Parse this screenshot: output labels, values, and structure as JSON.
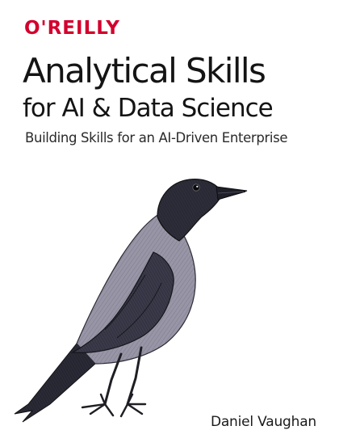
{
  "publisher": {
    "name": "O'REILLY",
    "color": "#d3002d"
  },
  "book": {
    "title_line1": "Analytical Skills",
    "title_line2": "for AI & Data Science",
    "subtitle": "Building Skills for an AI-Driven Enterprise",
    "author": "Daniel Vaughan"
  },
  "illustration": {
    "subject": "crow",
    "colors": {
      "head": "#2b2b38",
      "body": "#8e8c9c",
      "wing": "#3a3a48",
      "legs": "#1e1e24"
    }
  }
}
